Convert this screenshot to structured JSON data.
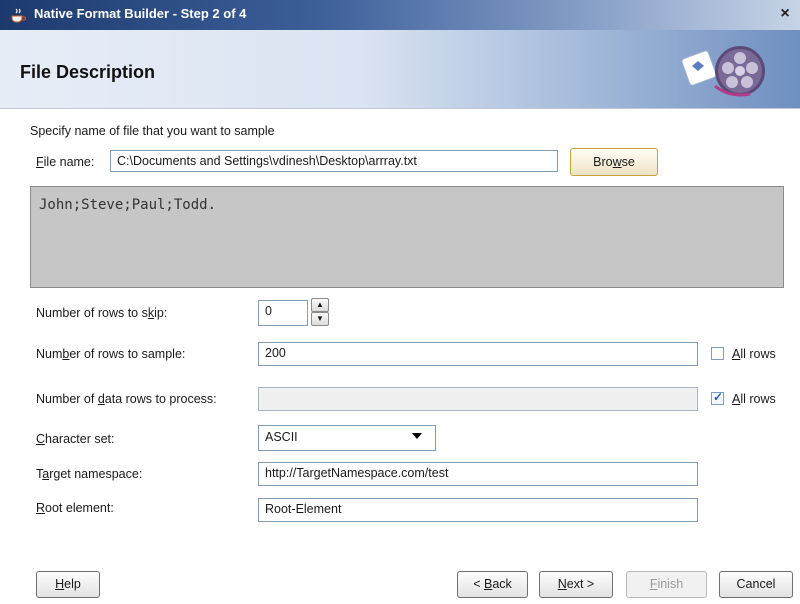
{
  "window": {
    "title": "Native Format Builder - Step 2 of 4",
    "close_glyph": "×"
  },
  "header": {
    "title": "File Description"
  },
  "instructions": "Specify name of file that you want to sample",
  "file": {
    "label_u": "F",
    "label_rest": "ile name:",
    "value": "C:\\Documents and Settings\\vdinesh\\Desktop\\arrray.txt",
    "browse_pre": "Bro",
    "browse_u": "w",
    "browse_post": "se"
  },
  "preview_text": "John;Steve;Paul;Todd.",
  "rows_to_skip": {
    "label_pre": "Number of rows to s",
    "label_u": "k",
    "label_post": "ip:",
    "value": "0"
  },
  "rows_to_sample": {
    "label_pre": "Num",
    "label_u": "b",
    "label_post": "er of rows to sample:",
    "value": "200",
    "all_u": "A",
    "all_rest": "ll rows",
    "all_checked": false
  },
  "data_rows": {
    "label_pre": "Number of ",
    "label_u": "d",
    "label_post": "ata rows to process:",
    "value": "",
    "all_u": "A",
    "all_rest": "ll rows",
    "all_checked": true
  },
  "charset": {
    "label_u": "C",
    "label_rest": "haracter set:",
    "value": "ASCII"
  },
  "target_ns": {
    "label_pre": "T",
    "label_u": "a",
    "label_post": "rget namespace:",
    "value": "http://TargetNamespace.com/test"
  },
  "root_element": {
    "label_u": "R",
    "label_rest": "oot element:",
    "value": "Root-Element"
  },
  "buttons": {
    "help_u": "H",
    "help_rest": "elp",
    "back_pre": "< ",
    "back_u": "B",
    "back_rest": "ack",
    "next_u": "N",
    "next_rest": "ext >",
    "finish_u": "F",
    "finish_rest": "inish",
    "cancel": "Cancel"
  },
  "colors": {
    "title_gradient_start": "#1d3a6e",
    "browse_border": "#c9a13a",
    "preview_bg": "#c6c6c6"
  }
}
